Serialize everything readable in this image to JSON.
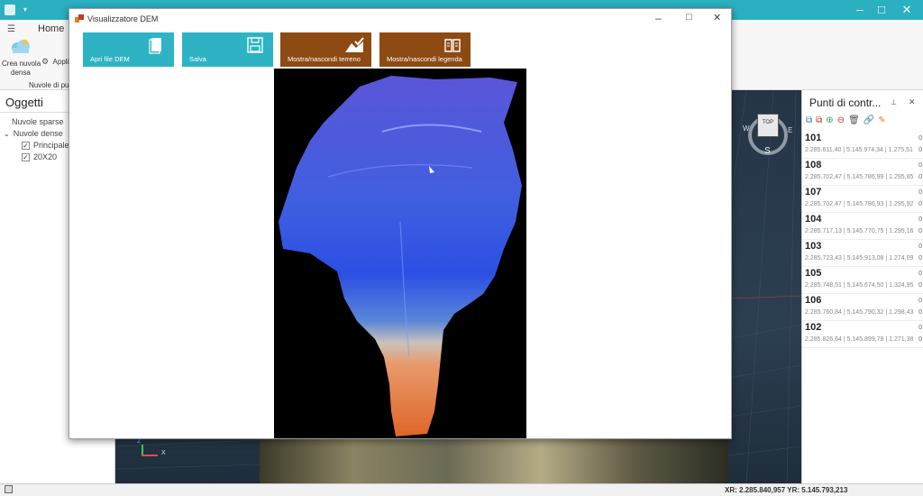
{
  "ribbon": {
    "home_tab": "Home",
    "create_label_line1": "Crea nuvola",
    "create_label_line2": "densa",
    "apply_label": "Appli",
    "group_label": "Nuvole di punt"
  },
  "left_panel": {
    "title": "Oggetti",
    "items": [
      {
        "label": "Nuvole sparse"
      },
      {
        "label": "Nuvole dense"
      },
      {
        "label": "Principale"
      },
      {
        "label": "20X20"
      }
    ]
  },
  "right_panel": {
    "title": "Punti di contr...",
    "points": [
      {
        "id": "101",
        "coords": "2.285.611,40 | 5.145.974,34 | 1.275,51",
        "val": "0"
      },
      {
        "id": "108",
        "coords": "2.285.702,47 | 5.145.786,99 | 1.295,85",
        "val": "0"
      },
      {
        "id": "107",
        "coords": "2.285.702,47 | 5.145.786,93 | 1.295,92",
        "val": "0"
      },
      {
        "id": "104",
        "coords": "2.285.717,13 | 5.145.770,75 | 1.295,16",
        "val": "0"
      },
      {
        "id": "103",
        "coords": "2.285.723,43 | 5.145.913,08 | 1.274,09",
        "val": "0"
      },
      {
        "id": "105",
        "coords": "2.285.748,51 | 5.145.674,50 | 1.324,95",
        "val": "0"
      },
      {
        "id": "106",
        "coords": "2.285.760,84 | 5.145.790,32 | 1.298,43",
        "val": "0"
      },
      {
        "id": "102",
        "coords": "2.285.826,64 | 5.145.899,78 | 1.271,38",
        "val": "0"
      }
    ]
  },
  "viewport": {
    "cube_label": "TOP",
    "compass_w": "W",
    "compass_e": "E",
    "compass_s": "S",
    "axis_z": "Z",
    "axis_x": "X"
  },
  "statusbar": {
    "coords": "XR: 2.285.840,957  YR: 5.145.793,213"
  },
  "dem_dialog": {
    "title": "Visualizzatore DEM",
    "buttons": [
      {
        "label": "Apri file DEM",
        "color": "#2db3c4"
      },
      {
        "label": "Salva",
        "color": "#2db3c4"
      },
      {
        "label": "Mostra/nascondi terreno",
        "color": "#8d4a12"
      },
      {
        "label": "Mostra/nascondi legenda",
        "color": "#8d4a12"
      }
    ]
  },
  "colors": {
    "accent": "#2bb0c2",
    "dem_button_cyan": "#2db3c4",
    "dem_button_brown": "#8d4a12"
  }
}
